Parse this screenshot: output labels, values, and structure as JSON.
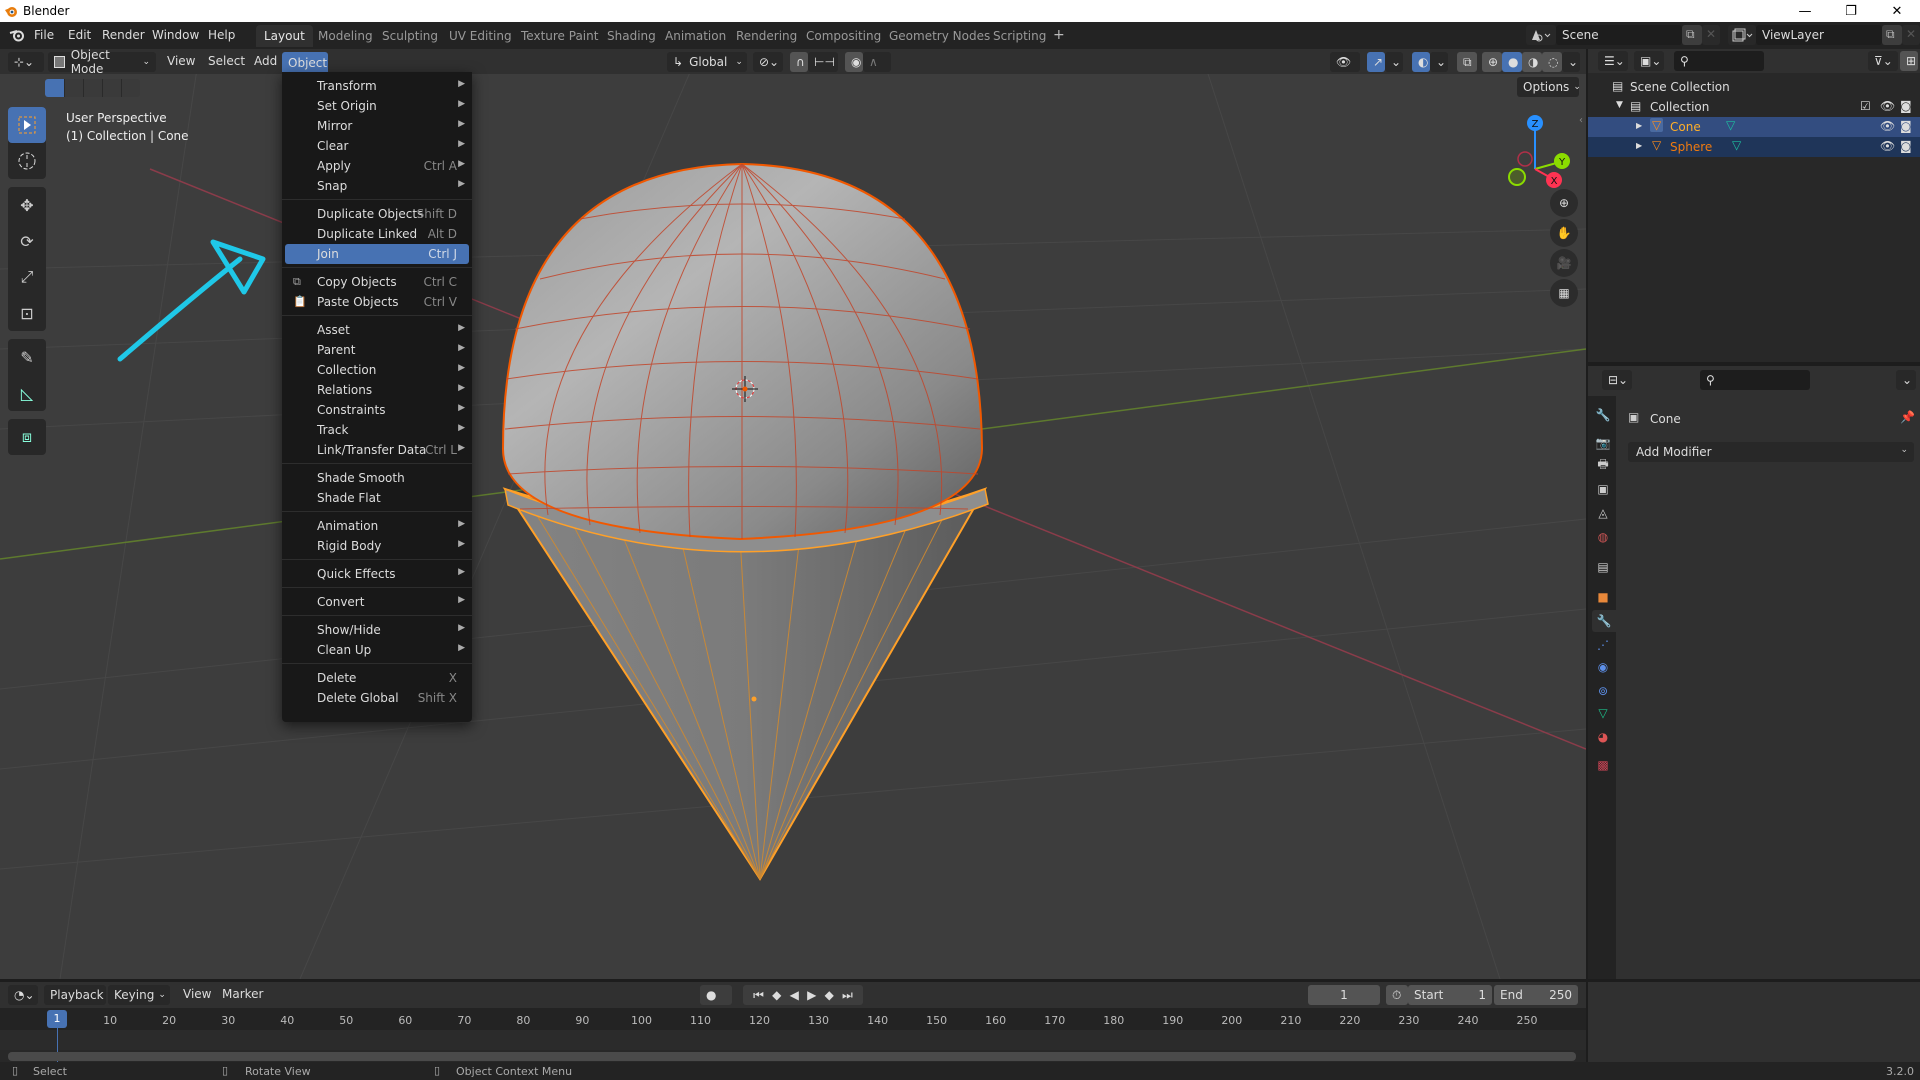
{
  "window": {
    "title": "Blender",
    "controls": {
      "minimize": "—",
      "maximize": "❐",
      "close": "✕"
    }
  },
  "topbar": {
    "menus": [
      "File",
      "Edit",
      "Render",
      "Window",
      "Help"
    ],
    "workspaces": [
      "Layout",
      "Modeling",
      "Sculpting",
      "UV Editing",
      "Texture Paint",
      "Shading",
      "Animation",
      "Rendering",
      "Compositing",
      "Geometry Nodes",
      "Scripting"
    ],
    "active_workspace": "Layout",
    "add_workspace": "+",
    "scene": "Scene",
    "view_layer": "ViewLayer"
  },
  "viewport": {
    "mode": "Object Mode",
    "menus": [
      "View",
      "Select",
      "Add",
      "Object"
    ],
    "active_menu": "Object",
    "orientation": "Global",
    "options_label": "Options",
    "overlay_line1": "User Perspective",
    "overlay_line2": "(1) Collection | Cone",
    "gizmo_axes": {
      "x": "X",
      "y": "Y",
      "z": "Z"
    },
    "colors": {
      "accent": "#4772b3",
      "selection_active": "#ffa028",
      "selection": "#f15800",
      "annotation": "#1fc8e8",
      "x_axis": "#ff3352",
      "y_axis": "#8bdc00",
      "z_axis": "#2890ff"
    }
  },
  "object_menu": {
    "groups": [
      [
        {
          "label": "Transform",
          "shortcut": "",
          "submenu": true
        },
        {
          "label": "Set Origin",
          "shortcut": "",
          "submenu": true
        },
        {
          "label": "Mirror",
          "shortcut": "",
          "submenu": true
        },
        {
          "label": "Clear",
          "shortcut": "",
          "submenu": true
        },
        {
          "label": "Apply",
          "shortcut": "Ctrl A",
          "submenu": true
        },
        {
          "label": "Snap",
          "shortcut": "",
          "submenu": true
        }
      ],
      [
        {
          "label": "Duplicate Objects",
          "shortcut": "Shift D",
          "submenu": false
        },
        {
          "label": "Duplicate Linked",
          "shortcut": "Alt D",
          "submenu": false
        },
        {
          "label": "Join",
          "shortcut": "Ctrl J",
          "submenu": false,
          "highlighted": true
        }
      ],
      [
        {
          "label": "Copy Objects",
          "shortcut": "Ctrl C",
          "submenu": false,
          "icon": "copy-icon"
        },
        {
          "label": "Paste Objects",
          "shortcut": "Ctrl V",
          "submenu": false,
          "icon": "paste-icon"
        }
      ],
      [
        {
          "label": "Asset",
          "shortcut": "",
          "submenu": true
        },
        {
          "label": "Parent",
          "shortcut": "",
          "submenu": true
        },
        {
          "label": "Collection",
          "shortcut": "",
          "submenu": true
        },
        {
          "label": "Relations",
          "shortcut": "",
          "submenu": true
        },
        {
          "label": "Constraints",
          "shortcut": "",
          "submenu": true
        },
        {
          "label": "Track",
          "shortcut": "",
          "submenu": true
        },
        {
          "label": "Link/Transfer Data",
          "shortcut": "Ctrl L",
          "submenu": true
        }
      ],
      [
        {
          "label": "Shade Smooth",
          "shortcut": "",
          "submenu": false
        },
        {
          "label": "Shade Flat",
          "shortcut": "",
          "submenu": false
        }
      ],
      [
        {
          "label": "Animation",
          "shortcut": "",
          "submenu": true
        },
        {
          "label": "Rigid Body",
          "shortcut": "",
          "submenu": true
        }
      ],
      [
        {
          "label": "Quick Effects",
          "shortcut": "",
          "submenu": true
        }
      ],
      [
        {
          "label": "Convert",
          "shortcut": "",
          "submenu": true
        }
      ],
      [
        {
          "label": "Show/Hide",
          "shortcut": "",
          "submenu": true
        },
        {
          "label": "Clean Up",
          "shortcut": "",
          "submenu": true
        }
      ],
      [
        {
          "label": "Delete",
          "shortcut": "X",
          "submenu": false
        },
        {
          "label": "Delete Global",
          "shortcut": "Shift X",
          "submenu": false
        }
      ]
    ]
  },
  "outliner": {
    "root": "Scene Collection",
    "collection": "Collection",
    "objects": [
      {
        "name": "Cone",
        "selected": true,
        "active": true
      },
      {
        "name": "Sphere",
        "selected": true,
        "active": false
      }
    ]
  },
  "properties": {
    "object_name": "Cone",
    "add_modifier_label": "Add Modifier",
    "active_tab": "modifiers"
  },
  "timeline": {
    "menus": [
      "Playback",
      "Keying",
      "View",
      "Marker"
    ],
    "current_frame": "1",
    "start_label": "Start",
    "start": "1",
    "end_label": "End",
    "end": "250",
    "ticks": [
      "10",
      "20",
      "30",
      "40",
      "50",
      "60",
      "70",
      "80",
      "90",
      "100",
      "110",
      "120",
      "130",
      "140",
      "150",
      "160",
      "170",
      "180",
      "190",
      "200",
      "210",
      "220",
      "230",
      "240",
      "250"
    ],
    "playhead": "1"
  },
  "statusbar": {
    "hints": [
      "Select",
      "Rotate View",
      "Object Context Menu"
    ],
    "version": "3.2.0"
  }
}
